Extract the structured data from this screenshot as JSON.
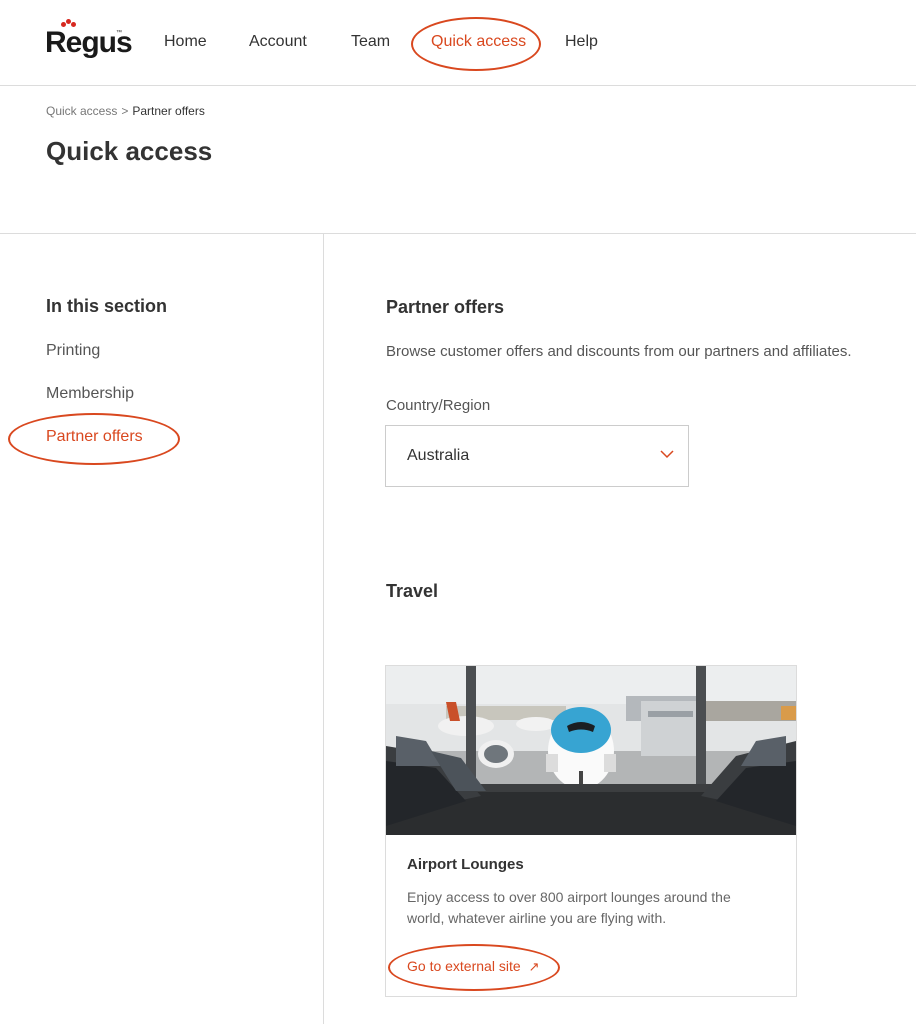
{
  "brand": {
    "name": "Regus",
    "tm": "™",
    "accent_color": "#d9481f",
    "logo_dot_color": "#d7281f"
  },
  "nav": {
    "items": [
      {
        "label": "Home"
      },
      {
        "label": "Account"
      },
      {
        "label": "Team"
      },
      {
        "label": "Quick access",
        "active": true
      },
      {
        "label": "Help"
      }
    ]
  },
  "breadcrumb": {
    "items": [
      "Quick access",
      "Partner offers"
    ],
    "separator": ">"
  },
  "page": {
    "title": "Quick access"
  },
  "sidebar": {
    "heading": "In this section",
    "items": [
      {
        "label": "Printing"
      },
      {
        "label": "Membership"
      },
      {
        "label": "Partner offers",
        "active": true
      }
    ]
  },
  "main": {
    "title": "Partner offers",
    "description": "Browse customer offers and discounts from our partners and affiliates.",
    "country": {
      "label": "Country/Region",
      "selected": "Australia",
      "icon": "chevron-down-icon"
    },
    "travel": {
      "heading": "Travel",
      "card": {
        "image": "airport-lounge-airplane-photo",
        "title": "Airport Lounges",
        "description": "Enjoy access to over 800 airport lounges around the world, whatever airline you are flying with.",
        "link_label": "Go to external site",
        "link_icon": "external-link-arrow-icon",
        "link_arrow": "↗"
      }
    }
  }
}
